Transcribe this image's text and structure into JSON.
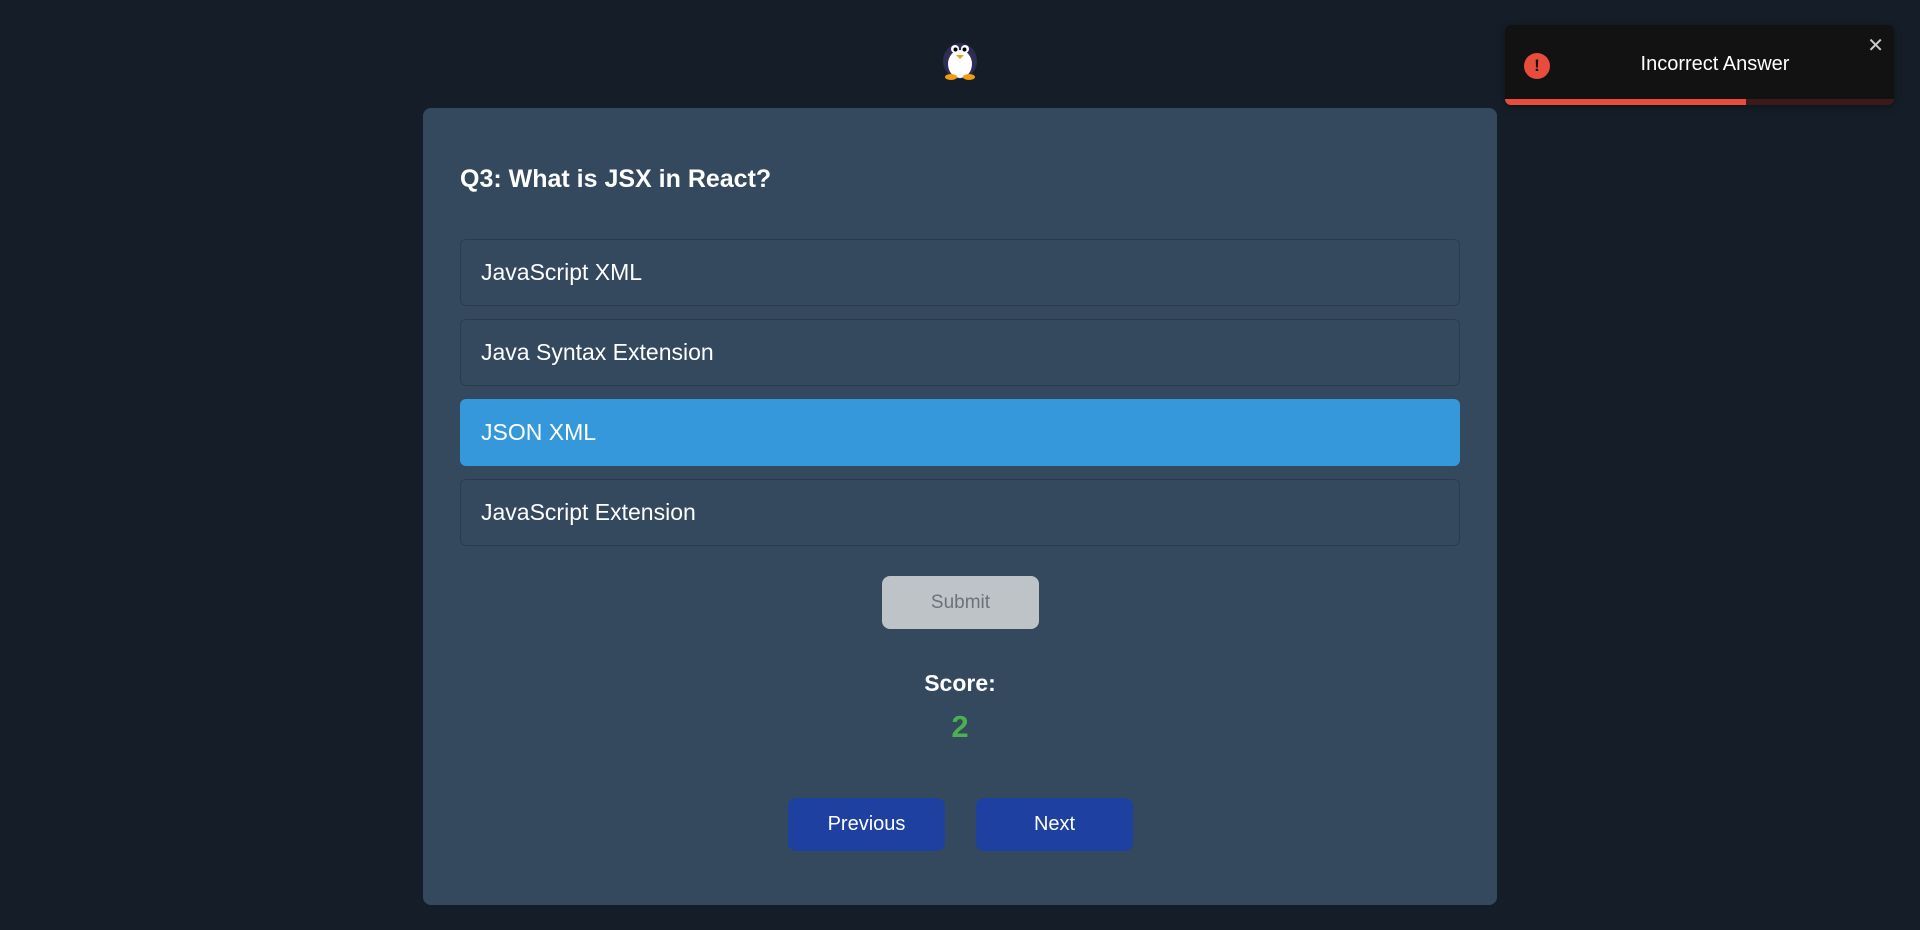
{
  "logo": {
    "icon": "penguin-icon"
  },
  "question": {
    "text": "Q3: What is JSX in React?"
  },
  "options": [
    {
      "label": "JavaScript XML",
      "selected": false
    },
    {
      "label": "Java Syntax Extension",
      "selected": false
    },
    {
      "label": "JSON XML",
      "selected": true
    },
    {
      "label": "JavaScript Extension",
      "selected": false
    }
  ],
  "submit": {
    "label": "Submit"
  },
  "score": {
    "label": "Score:",
    "value": "2"
  },
  "nav": {
    "previous_label": "Previous",
    "next_label": "Next"
  },
  "toast": {
    "icon": "error-icon",
    "message": "Incorrect Answer",
    "close": "✕",
    "progress_remaining": 0.62
  },
  "colors": {
    "background": "#151e28",
    "card": "#34495e",
    "selected": "#3498db",
    "score": "#4caf50",
    "nav_button": "#1e40a0",
    "error": "#e74c3c"
  }
}
